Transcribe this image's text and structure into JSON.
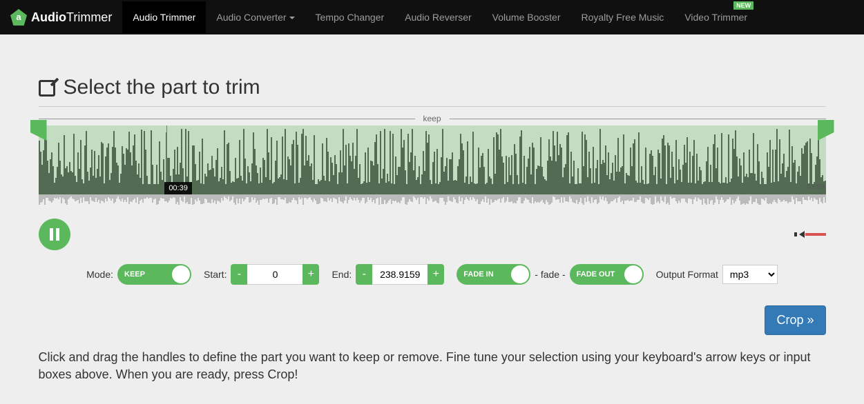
{
  "brand": {
    "name": "AudioTrimmer",
    "first": "Audio",
    "second": "Trimmer"
  },
  "nav": {
    "items": [
      {
        "label": "Audio Trimmer",
        "active": true
      },
      {
        "label": "Audio Converter",
        "dropdown": true
      },
      {
        "label": "Tempo Changer"
      },
      {
        "label": "Audio Reverser"
      },
      {
        "label": "Volume Booster"
      },
      {
        "label": "Royalty Free Music"
      },
      {
        "label": "Video Trimmer",
        "badge": "NEW"
      }
    ]
  },
  "header": {
    "title": "Select the part to trim"
  },
  "keep_label": "keep",
  "waveform": {
    "playhead_time": "00:39",
    "end_time": "03:59"
  },
  "settings": {
    "mode_label": "Mode:",
    "mode_value": "KEEP",
    "start_label": "Start:",
    "start_value": "0",
    "end_label": "End:",
    "end_value": "238.9159",
    "fade_in_label": "FADE IN",
    "fade_divider": "- fade -",
    "fade_out_label": "FADE OUT",
    "output_label": "Output Format",
    "output_value": "mp3",
    "minus": "-",
    "plus": "+"
  },
  "crop_button": "Crop »",
  "instructions": "Click and drag the handles to define the part you want to keep or remove. Fine tune your selection using your keyboard's arrow keys or input boxes above. When you are ready, press Crop!"
}
